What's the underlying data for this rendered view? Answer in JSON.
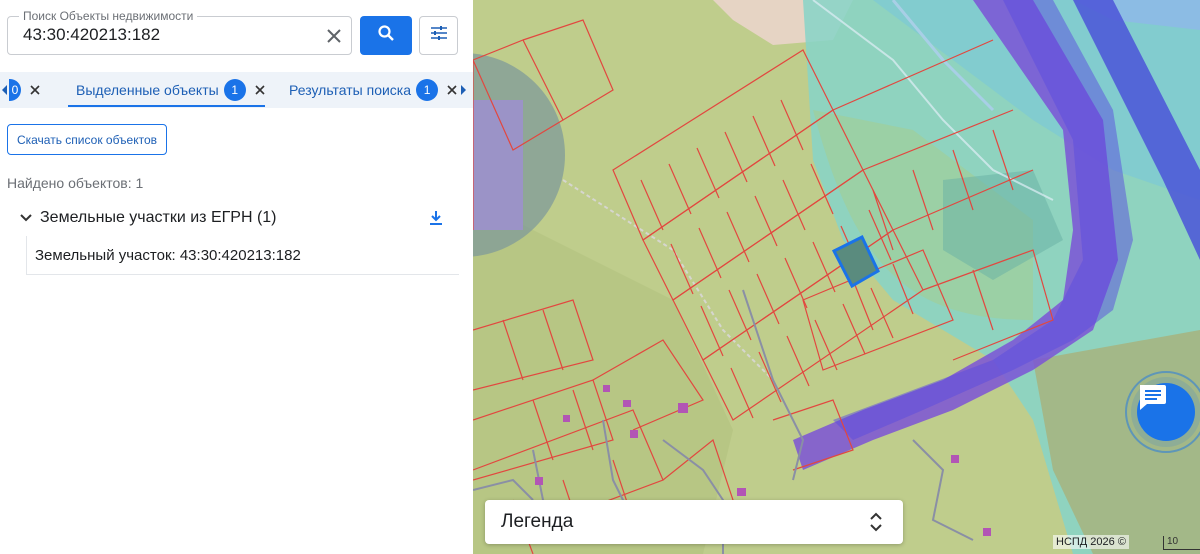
{
  "search": {
    "label": "Поиск Объекты недвижимости",
    "value": "43:30:420213:182"
  },
  "tabs": [
    {
      "label": "0"
    },
    {
      "label": "Выделенные объекты",
      "badge": "1"
    },
    {
      "label": "Результаты поиска",
      "badge": "1"
    }
  ],
  "actions": {
    "download_list": "Скачать список объектов"
  },
  "results": {
    "found": "Найдено объектов: 1",
    "group_title": "Земельные участки из ЕГРН (1)",
    "item": "Земельный участок: 43:30:420213:182"
  },
  "map": {
    "legend": "Легенда",
    "copyright": "НСПД 2026 ©",
    "scale": "10"
  },
  "colors": {
    "accent": "#1a73e8",
    "parcel_lines": "#e2473f",
    "selected_parcel": "#1a73e8",
    "zone_green": "#b9c98a",
    "zone_teal": "#7fd3c8",
    "zone_purple": "#7b52d6"
  },
  "icons": {
    "clear": "close-icon",
    "search": "search-icon",
    "filter": "tune-icon",
    "group_toggle": "chevron-down-icon",
    "group_download": "download-icon",
    "legend_toggle": "unfold-icon",
    "chat": "chat-icon"
  }
}
